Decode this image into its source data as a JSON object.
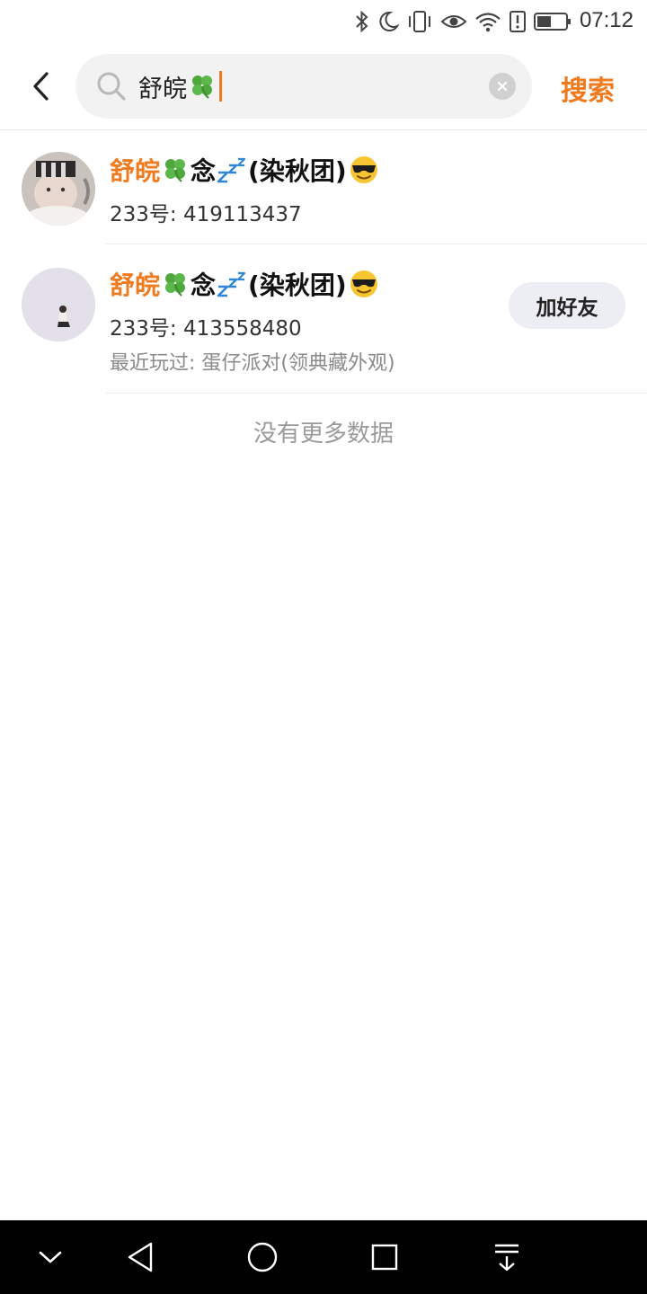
{
  "status_bar": {
    "time": "07:12",
    "icons": [
      "bluetooth-icon",
      "moon-icon",
      "vibrate-icon",
      "eye-icon",
      "wifi-icon",
      "alert-icon",
      "battery-icon"
    ]
  },
  "search": {
    "value": "舒皖",
    "value_emoji": "four-leaf-clover",
    "submit_label": "搜索"
  },
  "results": [
    {
      "name_highlight": "舒皖",
      "name_middle": "念",
      "name_rest": "(染秋团)",
      "emojis": [
        "four-leaf-clover",
        "zzz",
        "smiling-face-with-sunglasses"
      ],
      "id_text": "233号: 419113437"
    },
    {
      "name_highlight": "舒皖",
      "name_middle": "念",
      "name_rest": "(染秋团)",
      "emojis": [
        "four-leaf-clover",
        "zzz",
        "smiling-face-with-sunglasses"
      ],
      "id_text": "233号: 413558480",
      "recent_text": "最近玩过: 蛋仔派对(领典藏外观)",
      "add_label": "加好友"
    }
  ],
  "no_more_text": "没有更多数据",
  "nav_bar": {
    "icons": [
      "chevron-down-icon",
      "back-triangle-icon",
      "home-circle-icon",
      "recents-square-icon",
      "download-icon"
    ]
  },
  "colors": {
    "accent": "#f07a1e",
    "search_bg": "#f2f2f2",
    "button_bg": "#eceef3"
  }
}
